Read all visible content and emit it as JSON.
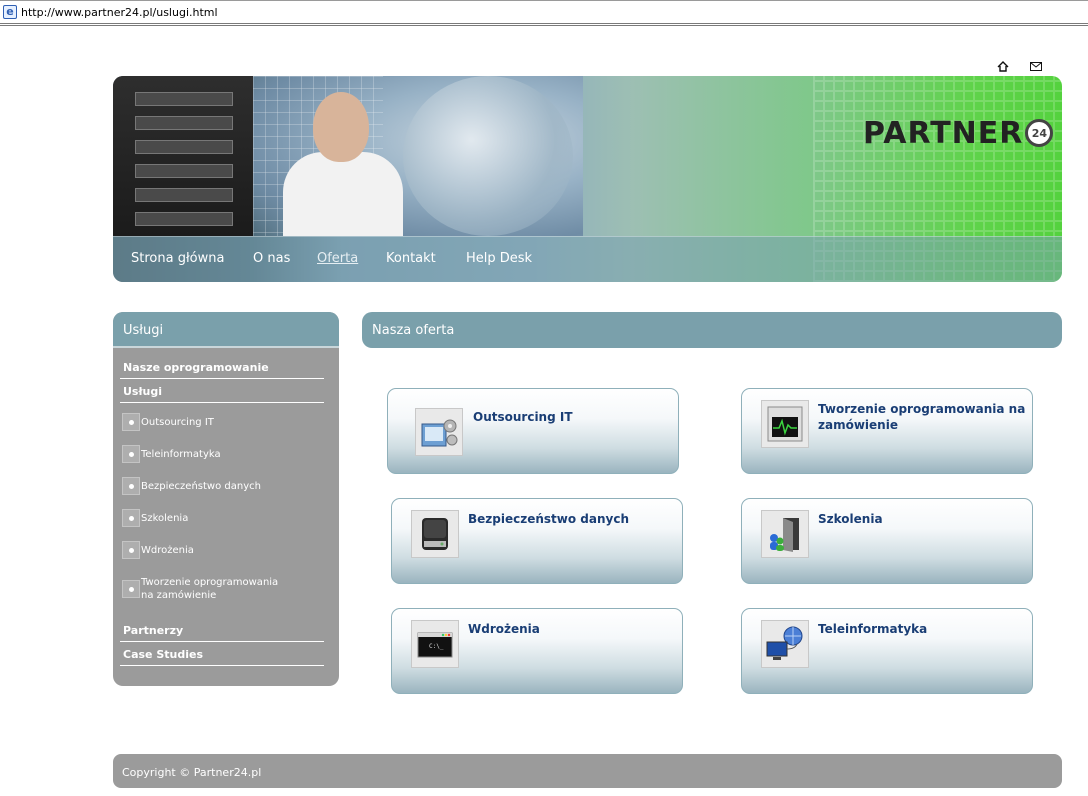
{
  "browser": {
    "url": "http://www.partner24.pl/uslugi.html",
    "ie_icon": "ie-icon"
  },
  "top_icons": [
    "home-icon",
    "mail-icon"
  ],
  "header": {
    "logo_text": "PARTNER",
    "logo_badge": "24"
  },
  "nav": {
    "items": [
      {
        "label": "Strona główna"
      },
      {
        "label": "O nas"
      },
      {
        "label": "Oferta"
      },
      {
        "label": "Kontakt"
      },
      {
        "label": "Help Desk"
      }
    ],
    "active": "Oferta"
  },
  "sidebar": {
    "title": "Usługi",
    "items": [
      {
        "label": "Nasze oprogramowanie"
      },
      {
        "label": "Usługi"
      }
    ],
    "subitems": [
      {
        "label": "Outsourcing IT"
      },
      {
        "label": "Teleinformatyka"
      },
      {
        "label": "Bezpieczeństwo danych"
      },
      {
        "label": "Szkolenia"
      },
      {
        "label": "Wdrożenia"
      },
      {
        "label": "Tworzenie oprogramowania na zamówienie"
      }
    ],
    "bottom_items": [
      {
        "label": "Partnerzy"
      },
      {
        "label": "Case Studies"
      }
    ]
  },
  "main": {
    "title": "Nasza oferta",
    "cards": [
      {
        "title": "Outsourcing IT",
        "icon": "outsourcing-icon"
      },
      {
        "title": "Tworzenie oprogramowania na zamówienie",
        "icon": "task-monitor-icon"
      },
      {
        "title": "Bezpieczeństwo danych",
        "icon": "hard-drive-icon"
      },
      {
        "title": "Szkolenia",
        "icon": "door-users-icon"
      },
      {
        "title": "Wdrożenia",
        "icon": "terminal-icon"
      },
      {
        "title": "Teleinformatyka",
        "icon": "network-globe-icon"
      }
    ]
  },
  "footer": {
    "text": "Copyright © Partner24.pl"
  },
  "colors": {
    "panel_header": "#7aa0ab",
    "panel_gray": "#9b9b9b",
    "card_title": "#1a3e75",
    "header_green": "#54d23e"
  }
}
